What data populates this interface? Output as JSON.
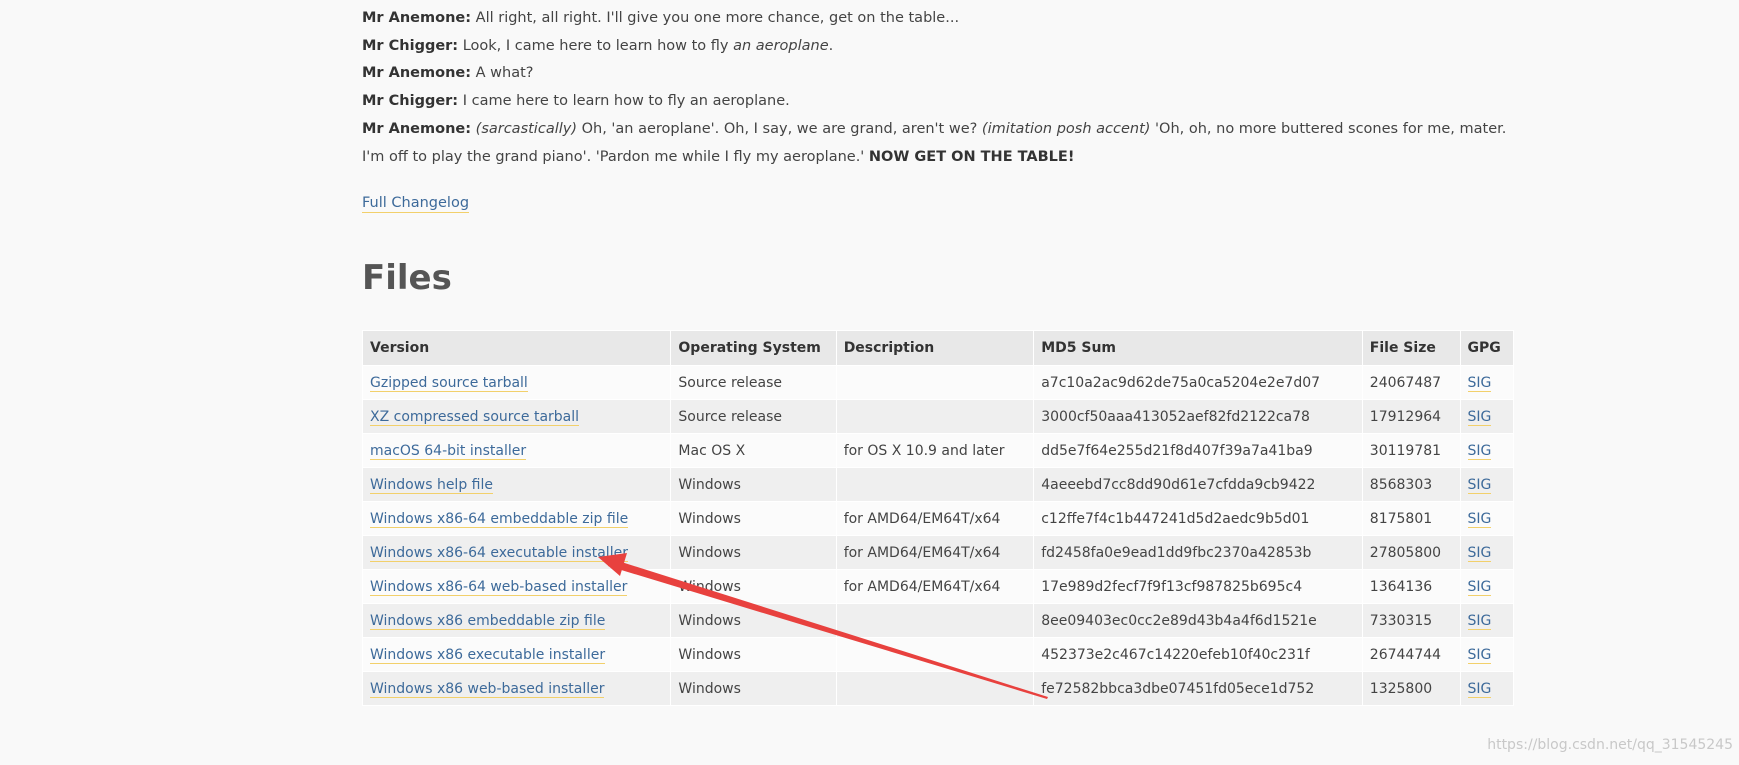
{
  "dialog": [
    {
      "speaker": "Mr Anemone:",
      "parts": [
        {
          "t": "text",
          "v": " All right, all right. I'll give you one more chance, get on the table..."
        }
      ]
    },
    {
      "speaker": "Mr Chigger:",
      "parts": [
        {
          "t": "text",
          "v": " Look, I came here to learn how to fly "
        },
        {
          "t": "italic",
          "v": "an aeroplane"
        },
        {
          "t": "text",
          "v": "."
        }
      ]
    },
    {
      "speaker": "Mr Anemone:",
      "parts": [
        {
          "t": "text",
          "v": " A what?"
        }
      ]
    },
    {
      "speaker": "Mr Chigger:",
      "parts": [
        {
          "t": "text",
          "v": " I came here to learn how to fly an aeroplane."
        }
      ]
    },
    {
      "speaker": "Mr Anemone:",
      "parts": [
        {
          "t": "text",
          "v": " "
        },
        {
          "t": "italic",
          "v": "(sarcastically)"
        },
        {
          "t": "text",
          "v": " Oh, 'an aeroplane'. Oh, I say, we are grand, aren't we? "
        },
        {
          "t": "italic",
          "v": "(imitation posh accent)"
        },
        {
          "t": "text",
          "v": " 'Oh, oh, no more buttered scones for me, mater. I'm off to play the grand piano'. 'Pardon me while I fly my aeroplane.' "
        },
        {
          "t": "bold",
          "v": "NOW GET ON THE TABLE!"
        }
      ]
    }
  ],
  "changelog_link": "Full Changelog",
  "files_title": "Files",
  "table": {
    "headers": [
      "Version",
      "Operating System",
      "Description",
      "MD5 Sum",
      "File Size",
      "GPG"
    ],
    "rows": [
      {
        "version": "Gzipped source tarball",
        "os": "Source release",
        "description": "",
        "md5": "a7c10a2ac9d62de75a0ca5204e2e7d07",
        "size": "24067487",
        "gpg": "SIG"
      },
      {
        "version": "XZ compressed source tarball",
        "os": "Source release",
        "description": "",
        "md5": "3000cf50aaa413052aef82fd2122ca78",
        "size": "17912964",
        "gpg": "SIG"
      },
      {
        "version": "macOS 64-bit installer",
        "os": "Mac OS X",
        "description": "for OS X 10.9 and later",
        "md5": "dd5e7f64e255d21f8d407f39a7a41ba9",
        "size": "30119781",
        "gpg": "SIG"
      },
      {
        "version": "Windows help file",
        "os": "Windows",
        "description": "",
        "md5": "4aeeebd7cc8dd90d61e7cfdda9cb9422",
        "size": "8568303",
        "gpg": "SIG"
      },
      {
        "version": "Windows x86-64 embeddable zip file",
        "os": "Windows",
        "description": "for AMD64/EM64T/x64",
        "md5": "c12ffe7f4c1b447241d5d2aedc9b5d01",
        "size": "8175801",
        "gpg": "SIG"
      },
      {
        "version": "Windows x86-64 executable installer",
        "os": "Windows",
        "description": "for AMD64/EM64T/x64",
        "md5": "fd2458fa0e9ead1dd9fbc2370a42853b",
        "size": "27805800",
        "gpg": "SIG"
      },
      {
        "version": "Windows x86-64 web-based installer",
        "os": "Windows",
        "description": "for AMD64/EM64T/x64",
        "md5": "17e989d2fecf7f9f13cf987825b695c4",
        "size": "1364136",
        "gpg": "SIG"
      },
      {
        "version": "Windows x86 embeddable zip file",
        "os": "Windows",
        "description": "",
        "md5": "8ee09403ec0cc2e89d43b4a4f6d1521e",
        "size": "7330315",
        "gpg": "SIG"
      },
      {
        "version": "Windows x86 executable installer",
        "os": "Windows",
        "description": "",
        "md5": "452373e2c467c14220efeb10f40c231f",
        "size": "26744744",
        "gpg": "SIG"
      },
      {
        "version": "Windows x86 web-based installer",
        "os": "Windows",
        "description": "",
        "md5": "fe72582bbca3dbe07451fd05ece1d752",
        "size": "1325800",
        "gpg": "SIG"
      }
    ]
  },
  "annotation": {
    "color": "#e8413e",
    "points_to": "Windows x86-64 executable installer"
  },
  "watermark": "https://blog.csdn.net/qq_31545245",
  "colors": {
    "link": "#3d6a9a",
    "link_underline": "#f2d06b",
    "header_bg": "#e8e8e8"
  }
}
